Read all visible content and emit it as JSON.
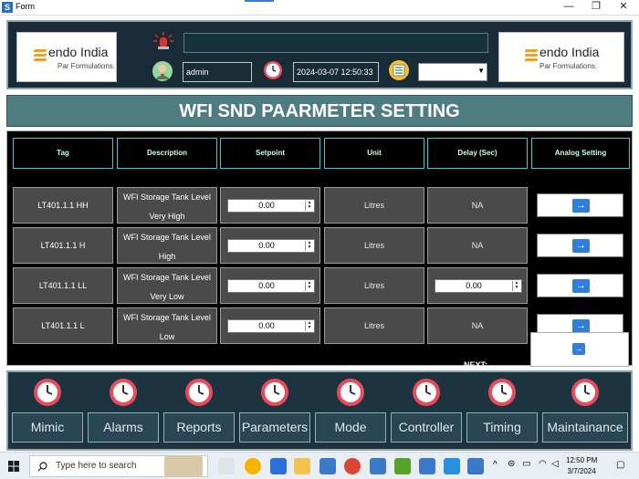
{
  "window": {
    "title": "Form",
    "app_icon_letter": "S",
    "minimize_glyph": "—",
    "maximize_glyph": "❐",
    "close_glyph": "✕"
  },
  "header": {
    "logo_brand": "endo",
    "logo_brand_suffix": " India",
    "logo_tagline": "Par Formulations.",
    "user": "admin",
    "datetime": "2024-03-07 12:50:33",
    "dropdown_value": ""
  },
  "banner": {
    "title": "WFI SND PAARMETER SETTING"
  },
  "table": {
    "columns": [
      "Tag",
      "Description",
      "Setpoint",
      "Unit",
      "Delay (Sec)",
      "Analog Setting"
    ],
    "rows": [
      {
        "tag": "LT401.1.1 HH",
        "desc1": "WFI Storage Tank Level",
        "desc2": "Very High",
        "setpoint": "0.00",
        "unit": "Litres",
        "delay": "NA"
      },
      {
        "tag": "LT401.1.1 H",
        "desc1": "WFI Storage Tank Level",
        "desc2": "High",
        "setpoint": "0.00",
        "unit": "Litres",
        "delay": "NA"
      },
      {
        "tag": "LT401.1.1  LL",
        "desc1": "WFI Storage Tank Level",
        "desc2": "Very Low",
        "setpoint": "0.00",
        "unit": "Litres",
        "delay": "0.00"
      },
      {
        "tag": "LT401.1.1 L",
        "desc1": "WFI Storage Tank Level",
        "desc2": "Low",
        "setpoint": "0.00",
        "unit": "Litres",
        "delay": "NA"
      }
    ],
    "next_label": "NEXT:"
  },
  "nav": [
    "Mimic",
    "Alarms",
    "Reports",
    "Parameters",
    "Mode",
    "Controller",
    "Timing",
    "Maintainance"
  ],
  "taskbar": {
    "search_placeholder": "Type here to search",
    "time": "12:50 PM",
    "date": "3/7/2024"
  }
}
